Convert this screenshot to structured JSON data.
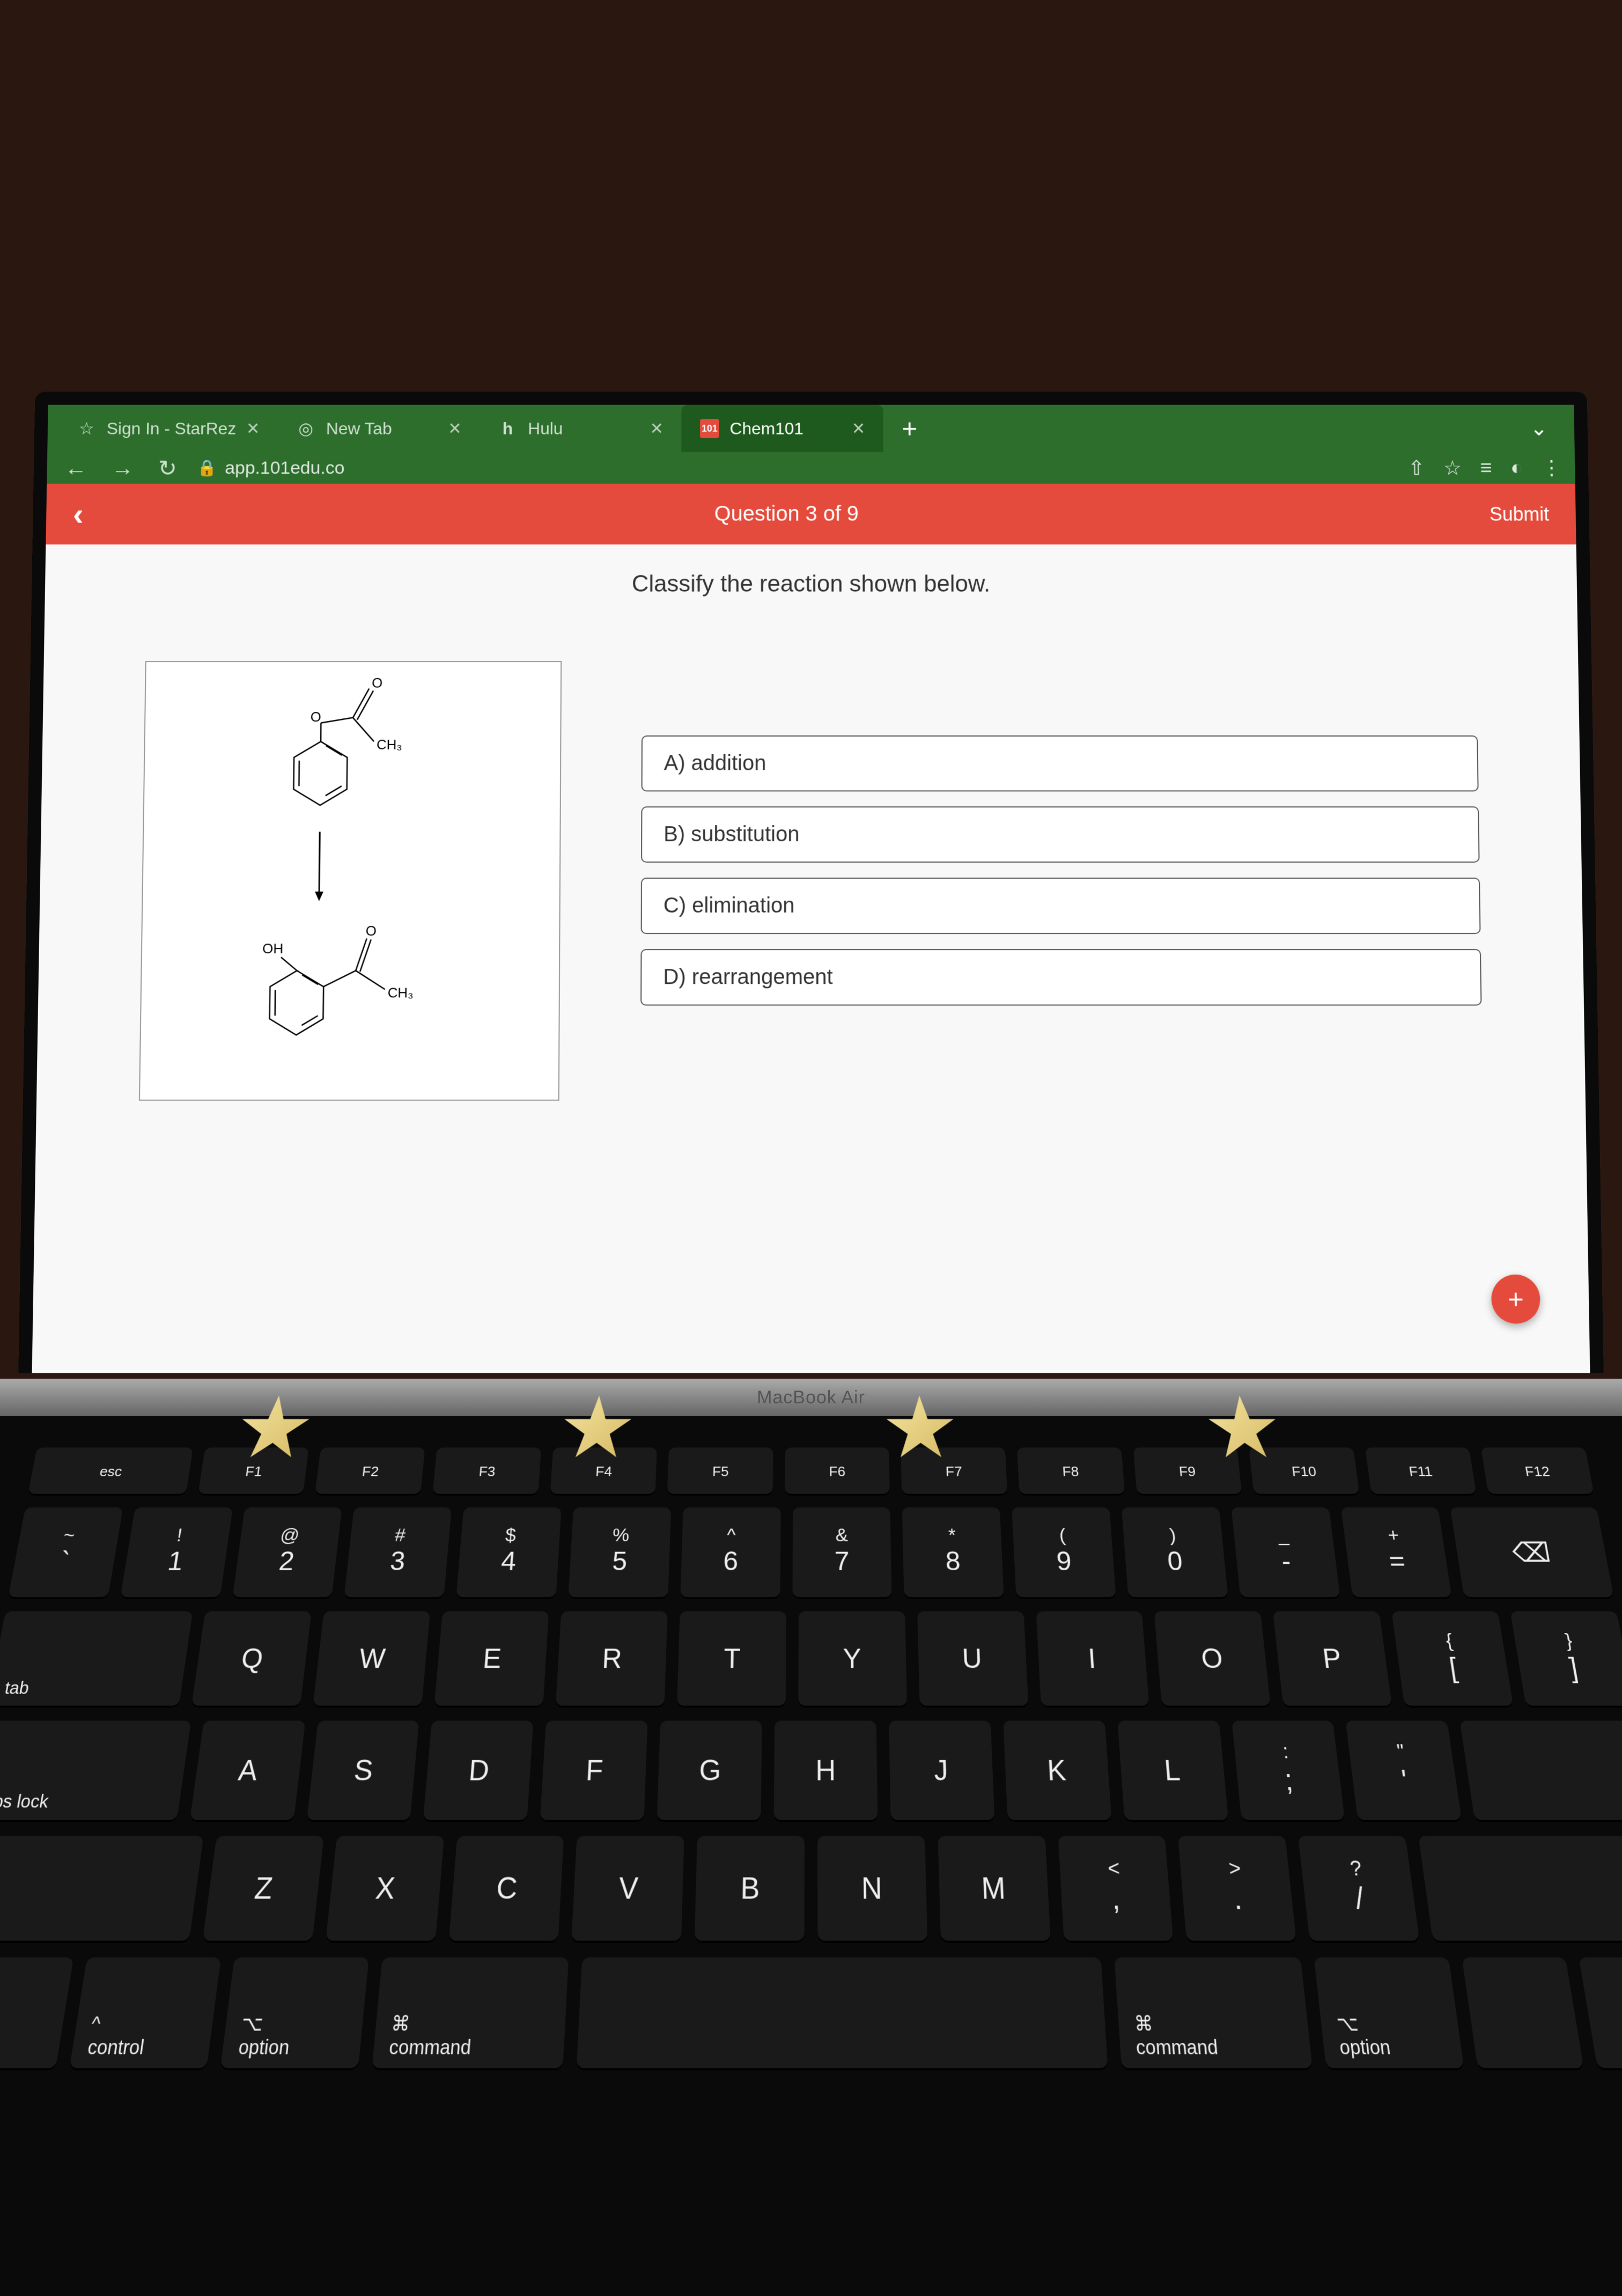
{
  "browser": {
    "tabs": [
      {
        "label": "Sign In - StarRez"
      },
      {
        "label": "New Tab"
      },
      {
        "label": "Hulu",
        "prefix": "h"
      },
      {
        "label": "Chem101",
        "prefix": "101",
        "active": true
      }
    ],
    "url": "app.101edu.co"
  },
  "header": {
    "counter": "Question 3 of 9",
    "submit": "Submit"
  },
  "question": {
    "prompt": "Classify the reaction shown below.",
    "molecule_labels": {
      "ch3_top": "CH₃",
      "oh": "OH",
      "o_top": "O",
      "o_mid": "O",
      "ch3_bot": "CH₃",
      "o_bot": "O"
    },
    "options": [
      {
        "label": "A) addition"
      },
      {
        "label": "B) substitution"
      },
      {
        "label": "C) elimination"
      },
      {
        "label": "D) rearrangement"
      }
    ]
  },
  "laptop_model": "MacBook Air",
  "keyboard": {
    "fn_row": [
      "esc",
      "F1",
      "F2",
      "F3",
      "F4",
      "F5",
      "F6",
      "F7",
      "F8",
      "F9",
      "F10",
      "F11",
      "F12"
    ],
    "num_row": [
      {
        "u": "~",
        "l": "`"
      },
      {
        "u": "!",
        "l": "1"
      },
      {
        "u": "@",
        "l": "2"
      },
      {
        "u": "#",
        "l": "3"
      },
      {
        "u": "$",
        "l": "4"
      },
      {
        "u": "%",
        "l": "5"
      },
      {
        "u": "^",
        "l": "6"
      },
      {
        "u": "&",
        "l": "7"
      },
      {
        "u": "*",
        "l": "8"
      },
      {
        "u": "(",
        "l": "9"
      },
      {
        "u": ")",
        "l": "0"
      },
      {
        "u": "_",
        "l": "-"
      },
      {
        "u": "+",
        "l": "="
      }
    ],
    "qwerty_row": [
      "Q",
      "W",
      "E",
      "R",
      "T",
      "Y",
      "U",
      "I",
      "O",
      "P"
    ],
    "qwerty_extra": [
      {
        "u": "{",
        "l": "["
      },
      {
        "u": "}",
        "l": "]"
      }
    ],
    "asdf_row": [
      "A",
      "S",
      "D",
      "F",
      "G",
      "H",
      "J",
      "K",
      "L"
    ],
    "asdf_extra": [
      {
        "u": ":",
        "l": ";"
      },
      {
        "u": "\"",
        "l": "'"
      }
    ],
    "zxcv_row": [
      "Z",
      "X",
      "C",
      "V",
      "B",
      "N",
      "M"
    ],
    "zxcv_extra": [
      {
        "u": "<",
        "l": ","
      },
      {
        "u": ">",
        "l": "."
      },
      {
        "u": "?",
        "l": "/"
      }
    ],
    "labels": {
      "tab": "tab",
      "caps": "aps lock",
      "control": "control",
      "option": "option",
      "command": "command"
    }
  }
}
